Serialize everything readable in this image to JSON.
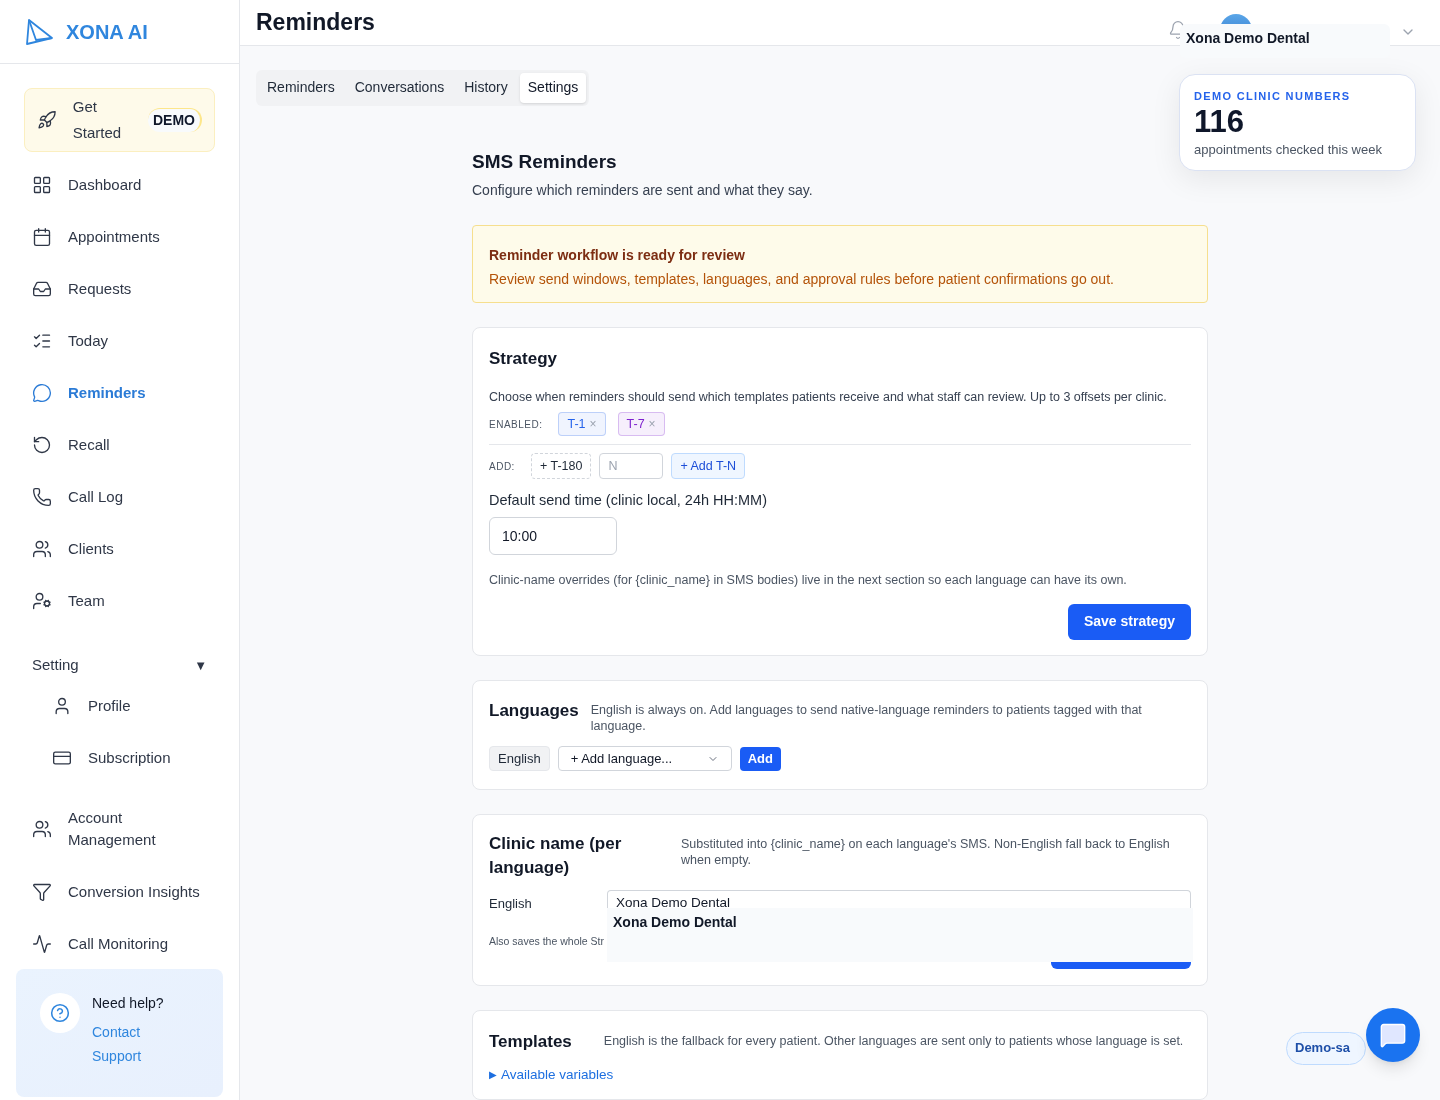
{
  "brand": {
    "name": "XONA AI"
  },
  "get_started": {
    "label": "Get Started",
    "badge": "DEMO"
  },
  "sidebar": {
    "items": [
      {
        "label": "Dashboard",
        "selected": false
      },
      {
        "label": "Appointments",
        "selected": false
      },
      {
        "label": "Requests",
        "selected": false
      },
      {
        "label": "Today",
        "selected": false
      },
      {
        "label": "Reminders",
        "selected": true
      },
      {
        "label": "Recall",
        "selected": false
      },
      {
        "label": "Call Log",
        "selected": false
      },
      {
        "label": "Clients",
        "selected": false
      },
      {
        "label": "Team",
        "selected": false
      }
    ],
    "group": {
      "label": "Setting",
      "caret": "▼",
      "expanded": true,
      "children": [
        {
          "label": "Profile",
          "selected": false
        },
        {
          "label": "Subscription",
          "selected": false
        }
      ]
    },
    "more": [
      {
        "label": "Account Management",
        "selected": false
      },
      {
        "label": "Conversion Insights",
        "selected": false
      },
      {
        "label": "Call Monitoring",
        "selected": false
      }
    ],
    "help": {
      "title": "Need help?",
      "link": "Contact Support"
    }
  },
  "header": {
    "title": "Reminders",
    "clinic_tooltip": "Xona Demo Dental"
  },
  "tabs": [
    {
      "label": "Reminders",
      "selected": false
    },
    {
      "label": "Conversations",
      "selected": false
    },
    {
      "label": "History",
      "selected": false
    },
    {
      "label": "Settings",
      "selected": true
    }
  ],
  "demo_card": {
    "label": "DEMO CLINIC NUMBERS",
    "value": "116",
    "caption": "appointments checked this week"
  },
  "page": {
    "title": "SMS Reminders",
    "subtitle": "Configure which reminders are sent and what they say."
  },
  "notice": {
    "title": "Reminder workflow is ready for review",
    "text": "Review send windows, templates, languages, and approval rules before patient confirmations go out."
  },
  "strategy": {
    "title": "Strategy",
    "description": "Choose when reminders should send which templates patients receive and what staff can review. Up to 3 offsets per clinic.",
    "enabled_label": "ENABLED:",
    "enabled": [
      {
        "label": "T-1",
        "remove": "×",
        "color": "#2563eb"
      },
      {
        "label": "T-7",
        "remove": "×",
        "color": "#7e22ce"
      }
    ],
    "add_label": "ADD:",
    "preset": "+ T-180",
    "n_placeholder": "N",
    "add_button": "+ Add T-N",
    "time_label": "Default send time (clinic local, 24h HH:MM)",
    "time_value": "10:00",
    "note": "Clinic-name overrides (for {clinic_name} in SMS bodies) live in the next section so each language can have its own.",
    "save": "Save strategy"
  },
  "languages": {
    "title": "Languages",
    "description": "English is always on. Add languages to send native-language reminders to patients tagged with that language.",
    "enabled": [
      "English"
    ],
    "select_placeholder": "+ Add language...",
    "add": "Add"
  },
  "clinic_name": {
    "title": "Clinic name (per language)",
    "description": "Substituted into {clinic_name} on each language's SMS. Non-English fall back to English when empty.",
    "rows": [
      {
        "language": "English",
        "value": "Xona Demo Dental"
      }
    ],
    "tooltip": "Xona Demo Dental",
    "footnote": "Also saves the whole Str"
  },
  "templates": {
    "title": "Templates",
    "description": "English is the fallback for every patient. Other languages are sent only to patients whose language is set.",
    "disclosure": "▶",
    "link": "Available variables"
  },
  "chat_pill": {
    "label": "Demo-sa"
  }
}
